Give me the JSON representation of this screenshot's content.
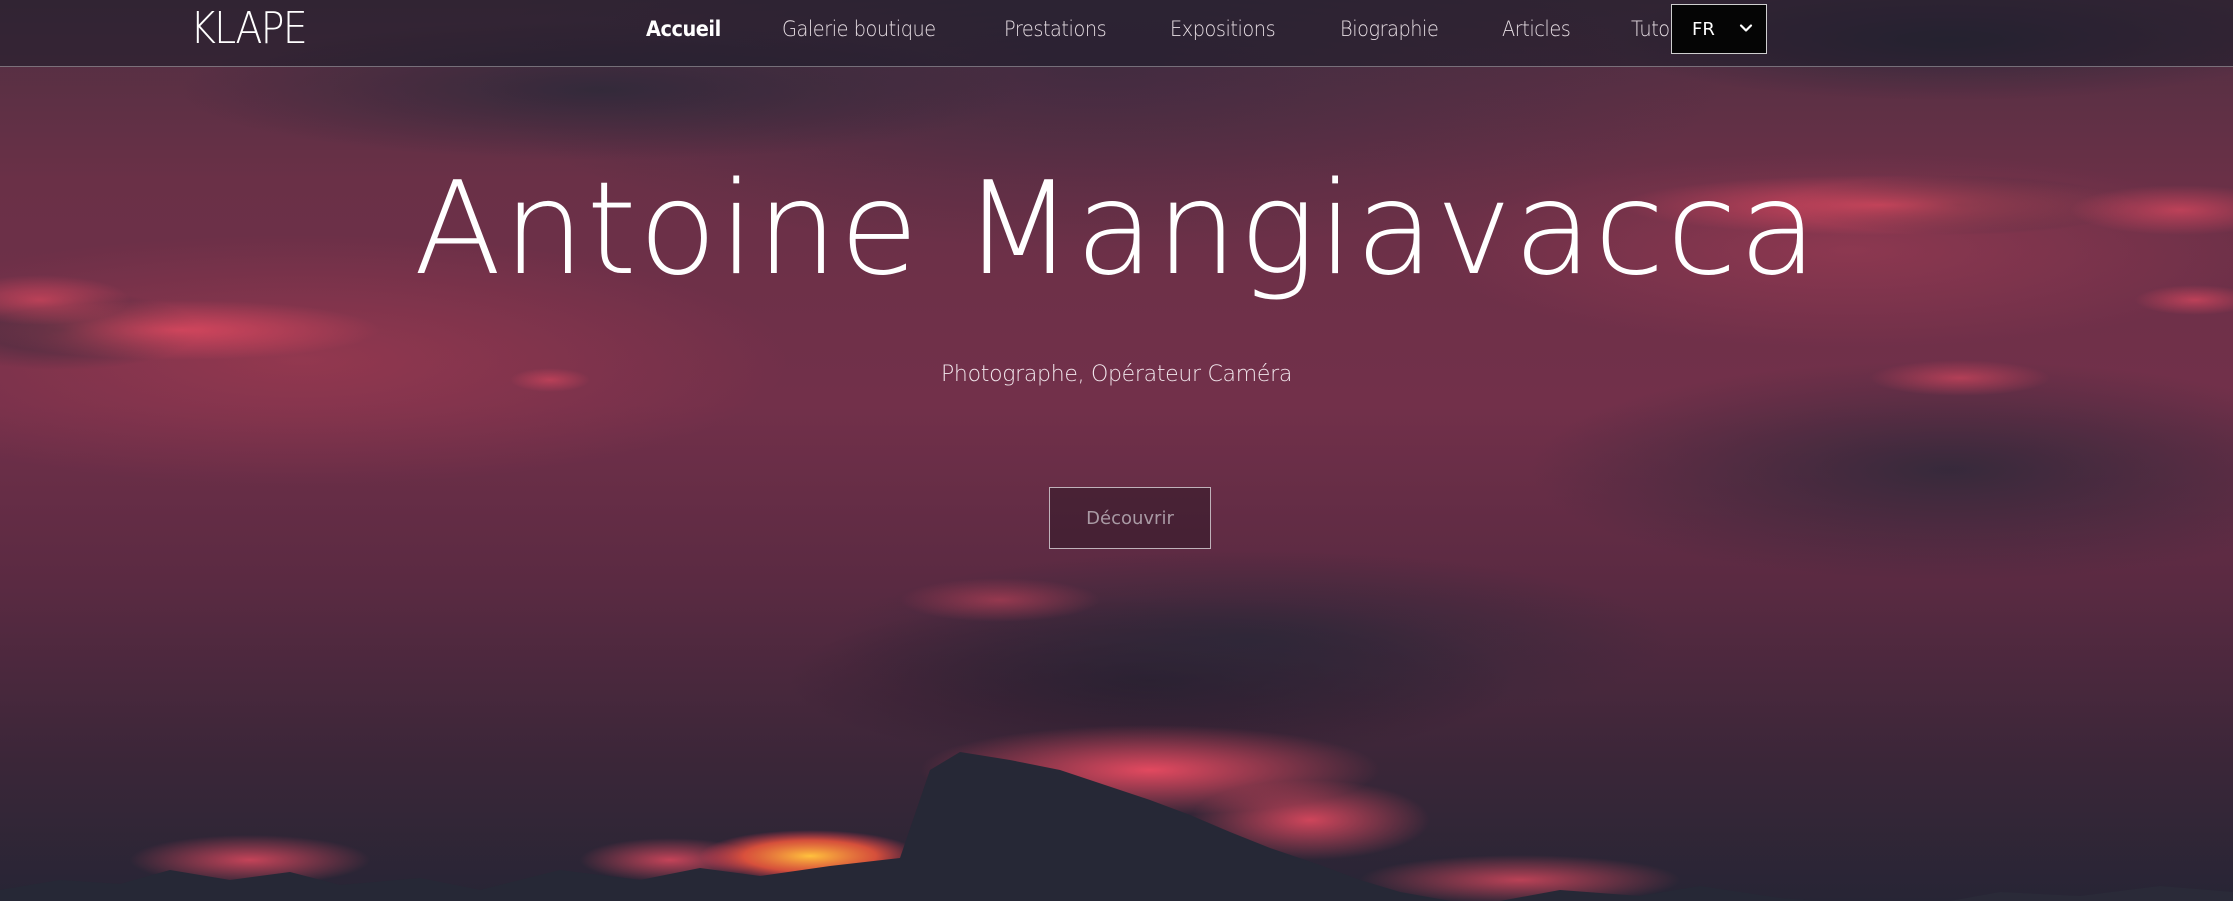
{
  "brand": {
    "logo_text": "KLAPE"
  },
  "nav": {
    "items": [
      {
        "label": "Accueil",
        "active": true
      },
      {
        "label": "Galerie boutique",
        "active": false
      },
      {
        "label": "Prestations",
        "active": false
      },
      {
        "label": "Expositions",
        "active": false
      },
      {
        "label": "Biographie",
        "active": false
      },
      {
        "label": "Articles",
        "active": false
      },
      {
        "label": "Tutoriels",
        "active": false
      }
    ],
    "language": {
      "selected": "FR",
      "icon": "chevron-down-icon"
    }
  },
  "hero": {
    "title": "Antoine Mangiavacca",
    "subtitle": "Photographe, Opérateur Caméra",
    "cta_label": "Découvrir"
  },
  "colors": {
    "nav_background": "#191c28",
    "sky_primary": "#72304a",
    "sky_dark": "#272535",
    "cloud_glow": "#ff4a5e",
    "sun_glow": "#ffb43a",
    "text": "#ffffff"
  }
}
